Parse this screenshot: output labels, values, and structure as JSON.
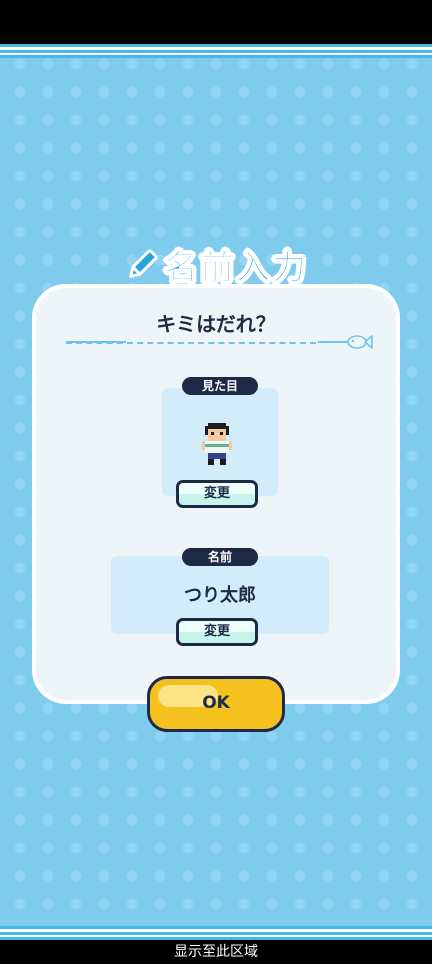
{
  "screen": {
    "title": "名前入力",
    "question": "キミはだれ？"
  },
  "appearance": {
    "label": "見た目",
    "change_label": "変更"
  },
  "name": {
    "label": "名前",
    "value": "つり太郎",
    "change_label": "変更"
  },
  "actions": {
    "ok_label": "OK"
  },
  "system": {
    "footer_text": "显示至此区域"
  },
  "icons": {
    "title": "pencil-icon",
    "divider": "fish-icon",
    "avatar": "pixel-character-avatar"
  },
  "colors": {
    "background": "#7ecbee",
    "title": "#2aa4dd",
    "dark": "#1e2a45",
    "ok_button": "#f5c11f",
    "change_button": "#c6f3ea"
  }
}
